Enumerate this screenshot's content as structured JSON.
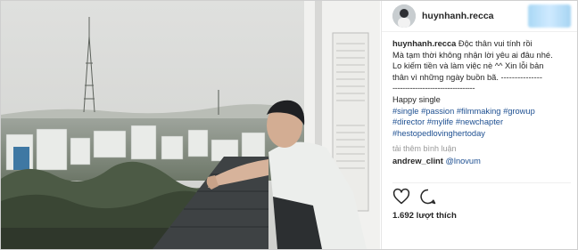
{
  "post": {
    "header": {
      "username": "huynhanh.recca"
    },
    "caption": {
      "username": "huynhanh.recca",
      "text_line1": "Độc thân vui tính rồi",
      "text_line2": "Mà tạm thời không nhận lời yêu ai đâu nhé.",
      "text_line3": "Lo kiếm tiền và làm việc nè ^^ Xin lỗi bản",
      "text_line4": "thân vì những ngày buồn bã. ---------------",
      "dashes": "---------------------------------",
      "subtitle": "Happy single",
      "hashtags": [
        "#single",
        "#passion",
        "#filmmaking",
        "#growup",
        "#director",
        "#mylife",
        "#newchapter",
        "#hestopedlovinghertoday"
      ]
    },
    "load_comments_label": "tải thêm bình luận",
    "comment": {
      "username": "andrew_clint",
      "mention": "@lnovum"
    },
    "likes": "1.692 lượt thích",
    "icons": {
      "like": "heart-icon",
      "comment": "comment-bubble-icon"
    }
  },
  "colors": {
    "hashtag": "#1d4f91",
    "muted": "#999999",
    "text": "#262626"
  }
}
